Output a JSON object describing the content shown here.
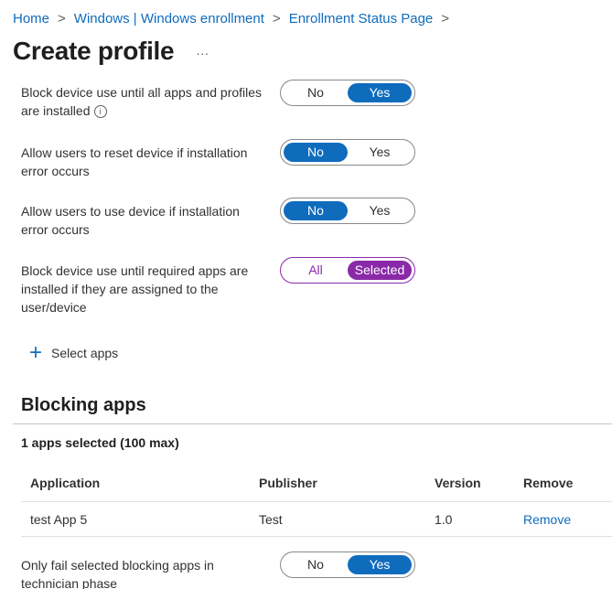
{
  "breadcrumb": {
    "items": [
      "Home",
      "Windows | Windows enrollment",
      "Enrollment Status Page"
    ],
    "separator": ">"
  },
  "page": {
    "title": "Create profile",
    "more": "···"
  },
  "settings": [
    {
      "label": "Block device use until all apps and profiles are installed",
      "has_info": true,
      "options": [
        "No",
        "Yes"
      ],
      "selected": "Yes"
    },
    {
      "label": "Allow users to reset device if installation error occurs",
      "options": [
        "No",
        "Yes"
      ],
      "selected": "No"
    },
    {
      "label": "Allow users to use device if installation error occurs",
      "options": [
        "No",
        "Yes"
      ],
      "selected": "No"
    },
    {
      "label": "Block device use until required apps are installed if they are assigned to the user/device",
      "options": [
        "All",
        "Selected"
      ],
      "selected": "Selected"
    }
  ],
  "select_apps": {
    "label": "Select apps",
    "icon": "plus-icon"
  },
  "blocking_apps": {
    "title": "Blocking apps",
    "count_label": "1 apps selected (100 max)",
    "columns": [
      "Application",
      "Publisher",
      "Version",
      "Remove"
    ],
    "rows": [
      {
        "application": "test App 5",
        "publisher": "Test",
        "version": "1.0",
        "remove": "Remove"
      }
    ]
  },
  "technician": {
    "label": "Only fail selected blocking apps in technician phase",
    "options": [
      "No",
      "Yes"
    ],
    "selected": "Yes"
  },
  "colors": {
    "accent": "#0f6cbd",
    "selected_purple": "#8a2aa8"
  }
}
